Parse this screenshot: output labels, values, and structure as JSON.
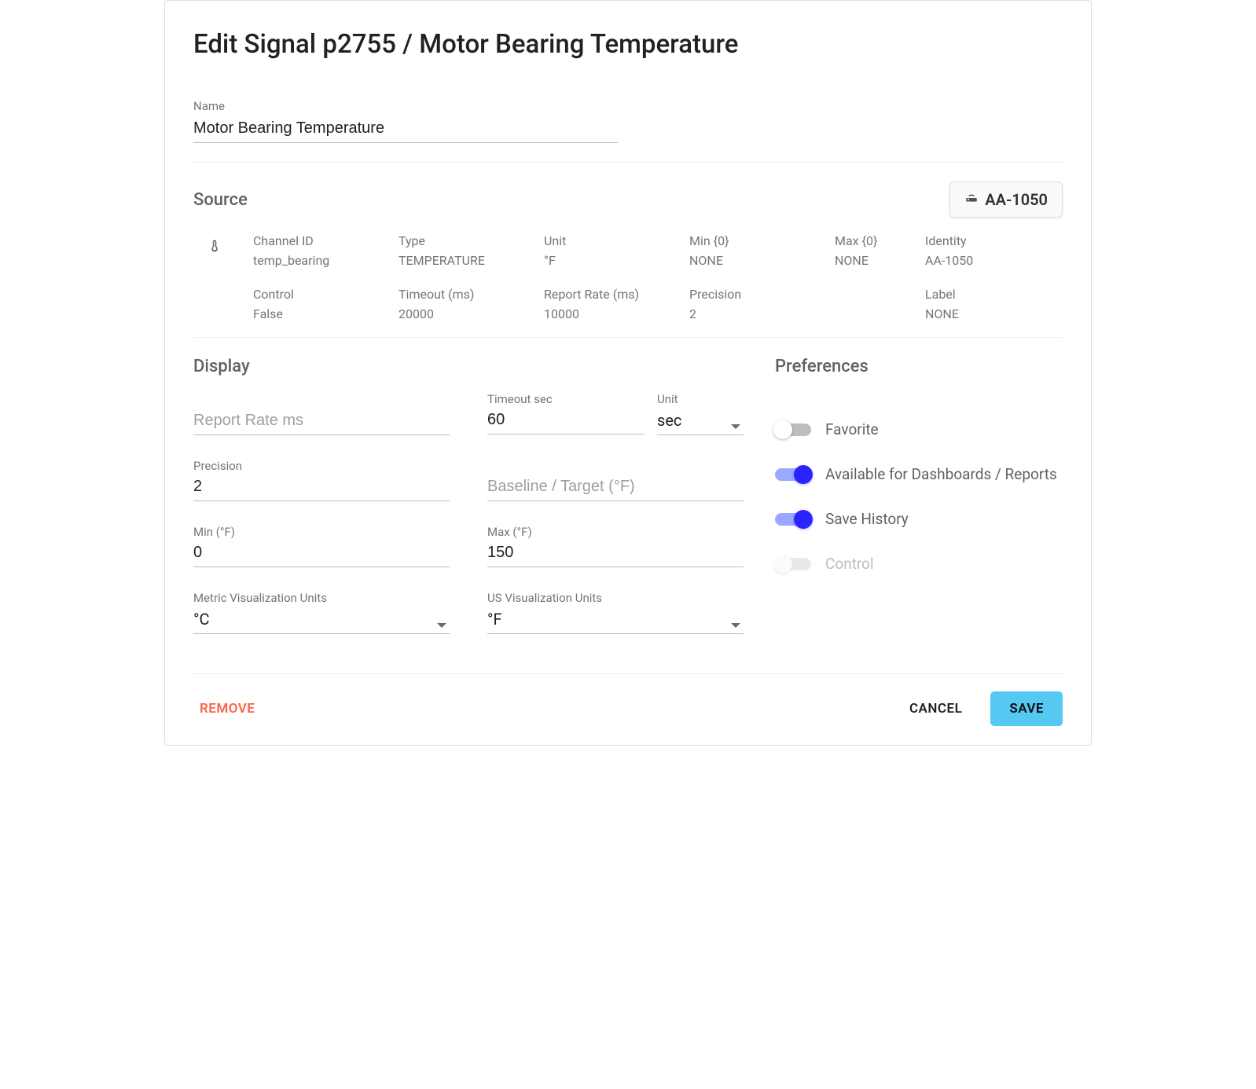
{
  "title": "Edit Signal p2755 / Motor Bearing Temperature",
  "name": {
    "label": "Name",
    "value": "Motor Bearing Temperature"
  },
  "source": {
    "heading": "Source",
    "chip": "AA-1050",
    "fields": {
      "channel_id": {
        "label": "Channel ID",
        "value": "temp_bearing"
      },
      "type": {
        "label": "Type",
        "value": "TEMPERATURE"
      },
      "unit": {
        "label": "Unit",
        "value": "°F"
      },
      "min": {
        "label": "Min {0}",
        "value": "NONE"
      },
      "max": {
        "label": "Max {0}",
        "value": "NONE"
      },
      "identity": {
        "label": "Identity",
        "value": "AA-1050"
      },
      "control": {
        "label": "Control",
        "value": "False"
      },
      "timeout": {
        "label": "Timeout (ms)",
        "value": "20000"
      },
      "report_rate": {
        "label": "Report Rate (ms)",
        "value": "10000"
      },
      "precision": {
        "label": "Precision",
        "value": "2"
      },
      "label": {
        "label": "Label",
        "value": "NONE"
      }
    }
  },
  "display": {
    "heading": "Display",
    "report_rate": {
      "placeholder": "Report Rate ms",
      "value": ""
    },
    "timeout_sec": {
      "label": "Timeout sec",
      "value": "60"
    },
    "timeout_unit": {
      "label": "Unit",
      "value": "sec"
    },
    "precision": {
      "label": "Precision",
      "value": "2"
    },
    "baseline": {
      "placeholder": "Baseline / Target (°F)",
      "value": ""
    },
    "min": {
      "label": "Min (°F)",
      "value": "0"
    },
    "max": {
      "label": "Max (°F)",
      "value": "150"
    },
    "metric_vis": {
      "label": "Metric Visualization Units",
      "value": "°C"
    },
    "us_vis": {
      "label": "US Visualization Units",
      "value": "°F"
    }
  },
  "preferences": {
    "heading": "Preferences",
    "favorite": {
      "label": "Favorite",
      "on": false,
      "disabled": false
    },
    "available": {
      "label": "Available for Dashboards / Reports",
      "on": true,
      "disabled": false
    },
    "save_history": {
      "label": "Save History",
      "on": true,
      "disabled": false
    },
    "control": {
      "label": "Control",
      "on": false,
      "disabled": true
    }
  },
  "footer": {
    "remove": "REMOVE",
    "cancel": "CANCEL",
    "save": "SAVE"
  }
}
